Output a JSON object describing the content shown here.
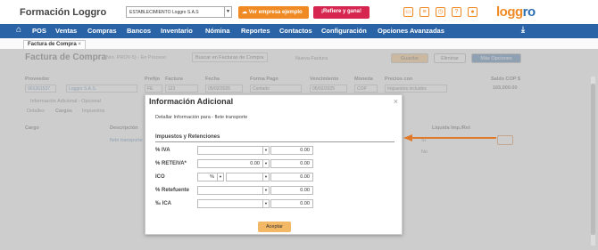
{
  "app": {
    "brand": "Formación Loggro",
    "company": "ESTABLECIMIENTO Loggro S.A.S",
    "demo_button": "Ver empresa ejemplo",
    "refer_button": "¡Refiere y gana!",
    "logo_main": "logg",
    "logo_accent": "ro"
  },
  "nav": {
    "items": [
      "POS",
      "Ventas",
      "Compras",
      "Bancos",
      "Inventario",
      "Nómina",
      "Reportes",
      "Contactos",
      "Configuración",
      "Opciones Avanzadas"
    ]
  },
  "tab": {
    "label": "Factura de Compra",
    "close": "×"
  },
  "background": {
    "title": "Factura de Compra",
    "subtitle": "(Nro. PROV-5) - En Proceso",
    "search_placeholder": "Buscar en Facturas de Compra",
    "new_invoice": "Nueva Factura",
    "save": "Guardar",
    "delete": "Eliminar",
    "more_options": "Más Opciones",
    "labels": {
      "provider": "Proveedor",
      "prefix": "Prefijo",
      "invoice": "Factura",
      "date": "Fecha",
      "payment": "Forma Pago",
      "due": "Vencimiento",
      "currency": "Moneda",
      "prices": "Precios con",
      "balance": "Saldo COP $"
    },
    "values": {
      "provider_id": "901261537",
      "provider_name": "Loggro S.A.S.",
      "prefix": "FE",
      "invoice": "123",
      "date": "05/02/2025",
      "payment": "Contado",
      "due": "05/02/2025",
      "currency": "COP",
      "prices": "Impuestos incluidos",
      "balance": "165,000.00"
    },
    "info_toggle": "Información Adicional - Opcional",
    "sub_tabs": [
      "Detalles",
      "Cargos",
      "Impuestos"
    ],
    "table_headers": {
      "cargo": "Cargo",
      "description": "Descripción",
      "liquida": "Liquida Imp./Ret"
    },
    "row_description": "flete transporte",
    "row_liquida": "Si",
    "row2_liquida": "No"
  },
  "modal": {
    "title": "Información Adicional",
    "close": "×",
    "description": "Detallar Información para - flete transporte",
    "section": "Impuestos y Retenciones",
    "rows": [
      {
        "label": "% IVA",
        "select": "",
        "value": "0.00"
      },
      {
        "label": "% RETEIVA*",
        "select": "0.00",
        "value": "0.00"
      },
      {
        "label": "ICO",
        "pct": "%",
        "select": "",
        "value": "0.00"
      },
      {
        "label": "% Retefuente",
        "select": "",
        "value": "0.00"
      },
      {
        "label": "‰ ICA",
        "select": "",
        "value": "0.00"
      }
    ],
    "accept": "Aceptar"
  },
  "colors": {
    "nav": "#2b64a6",
    "accent": "#f08a24",
    "refer": "#d6264f",
    "accept": "#f2b866"
  }
}
